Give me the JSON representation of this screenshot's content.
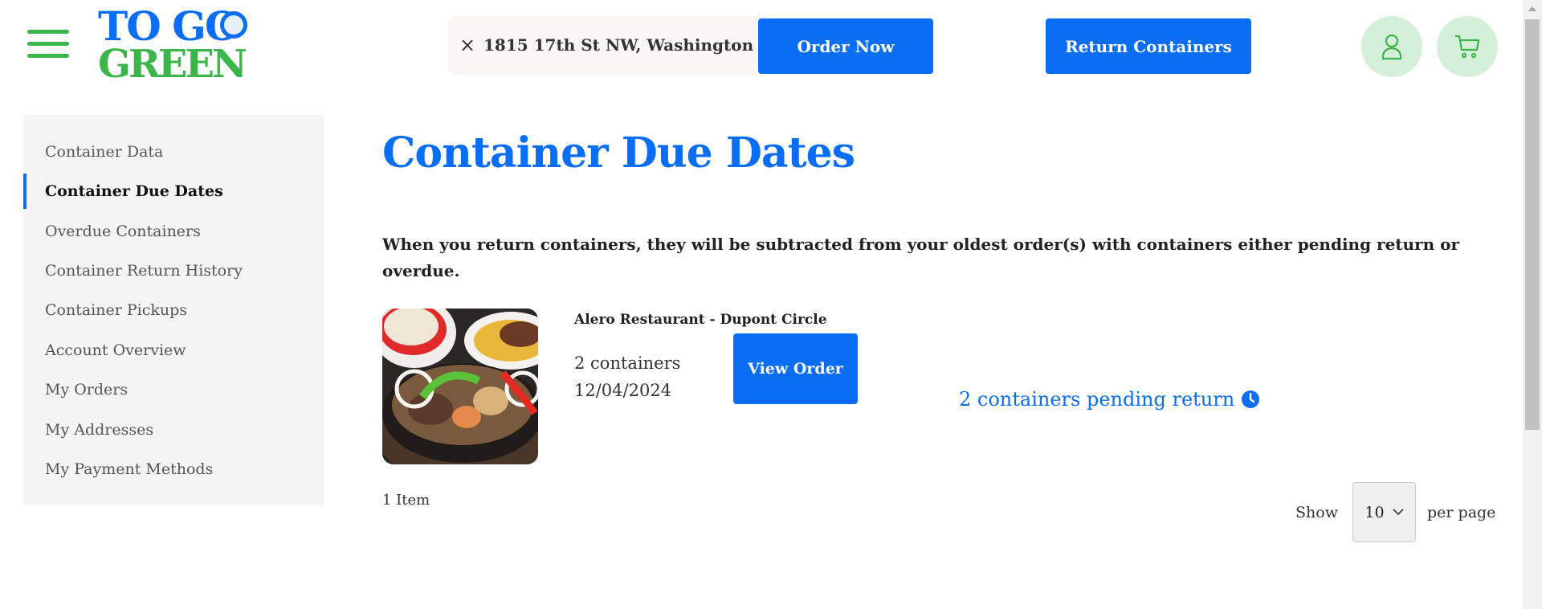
{
  "header": {
    "logo_line1": "TO GO",
    "logo_line2": "GREEN",
    "address": "1815 17th St NW, Washington",
    "clear_icon": "×",
    "order_now": "Order Now",
    "return_containers": "Return Containers",
    "icons": [
      "menu-icon",
      "user-icon",
      "cart-icon"
    ]
  },
  "sidebar": {
    "items": [
      {
        "label": "Container Data"
      },
      {
        "label": "Container Due Dates",
        "active": true
      },
      {
        "label": "Overdue Containers"
      },
      {
        "label": "Container Return History"
      },
      {
        "label": "Container Pickups"
      },
      {
        "label": "Account Overview"
      },
      {
        "label": "My Orders"
      },
      {
        "label": "My Addresses"
      },
      {
        "label": "My Payment Methods"
      }
    ]
  },
  "main": {
    "title": "Container Due Dates",
    "description": "When you return containers, they will be subtracted from your oldest order(s) with containers either pending return or overdue.",
    "orders": [
      {
        "restaurant": "Alero Restaurant - Dupont Circle",
        "containers": "2 containers",
        "date": "12/04/2024",
        "view_label": "View Order",
        "status": "2 containers pending return",
        "status_icon": "clock-icon"
      }
    ],
    "item_count": "1 Item",
    "pagination": {
      "show": "Show",
      "per_page_value": "10",
      "per_page": "per page"
    }
  },
  "colors": {
    "brand_blue": "#0a6ef5",
    "brand_green": "#3cb54a",
    "icon_bg": "#d5f0da"
  }
}
